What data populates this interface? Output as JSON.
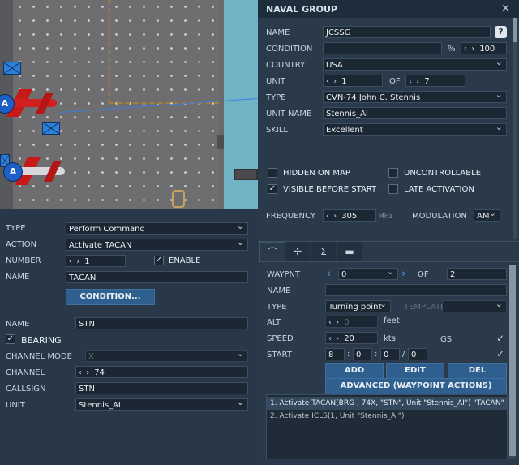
{
  "window": {
    "title": "NAVAL GROUP",
    "close_icon": "close-icon"
  },
  "group": {
    "name_label": "NAME",
    "name_value": "JCSSG",
    "help_label": "?",
    "condition_label": "CONDITION",
    "condition_value": "",
    "percent_label": "%",
    "percent_value": "100",
    "country_label": "COUNTRY",
    "country_value": "USA",
    "unit_label": "UNIT",
    "unit_value": "1",
    "of_label": "OF",
    "unit_total": "7",
    "type_label": "TYPE",
    "type_value": "CVN-74 John C. Stennis",
    "unit_name_label": "UNIT NAME",
    "unit_name_value": "Stennis_AI",
    "skill_label": "SKILL",
    "skill_value": "Excellent"
  },
  "flags": {
    "hidden_on_map": {
      "label": "HIDDEN ON MAP",
      "checked": false
    },
    "uncontrollable": {
      "label": "UNCONTROLLABLE",
      "checked": false
    },
    "visible_before_start": {
      "label": "VISIBLE BEFORE START",
      "checked": true
    },
    "late_activation": {
      "label": "LATE ACTIVATION",
      "checked": false
    }
  },
  "radio": {
    "frequency_label": "FREQUENCY",
    "frequency_value": "305",
    "frequency_unit": "MHz",
    "modulation_label": "MODULATION",
    "modulation_value": "AM"
  },
  "tabs": [
    {
      "icon": "route-icon",
      "glyph": "⌒",
      "active": true
    },
    {
      "icon": "aircraft-icon",
      "glyph": "✢",
      "active": false
    },
    {
      "icon": "sigma-icon",
      "glyph": "Σ",
      "active": false
    },
    {
      "icon": "payload-icon",
      "glyph": "▬",
      "active": false
    }
  ],
  "waypoint": {
    "wpt_label": "WAYPNT",
    "wpt_value": "0",
    "of_label": "OF",
    "wpt_total": "2",
    "name_label": "NAME",
    "name_value": "",
    "type_label": "TYPE",
    "type_value": "Turning point",
    "template_label": "TEMPLATE",
    "template_value": "",
    "alt_label": "ALT",
    "alt_value": "0",
    "alt_unit": "feet",
    "speed_label": "SPEED",
    "speed_value": "20",
    "speed_unit": "kts",
    "gs_label": "GS",
    "start_label": "START",
    "start_d": "8",
    "start_h": "0",
    "start_m": "0",
    "start_s": "0",
    "add_label": "ADD",
    "edit_label": "EDIT",
    "del_label": "DEL",
    "advanced_label": "ADVANCED (WAYPOINT ACTIONS)"
  },
  "actions": [
    "1. Activate TACAN(BRG , 74X, \"STN\", Unit \"Stennis_AI\")  \"TACAN\"",
    "2. Activate ICLS(1, Unit \"Stennis_AI\")"
  ],
  "command": {
    "type_label": "TYPE",
    "type_value": "Perform Command",
    "action_label": "ACTION",
    "action_value": "Activate TACAN",
    "number_label": "NUMBER",
    "number_value": "1",
    "enable_label": "ENABLE",
    "name_label": "NAME",
    "name_value": "TACAN",
    "condition_button": "CONDITION..."
  },
  "tacan": {
    "name_label": "NAME",
    "name_value": "STN",
    "bearing_label": "BEARING",
    "channel_mode_label": "CHANNEL MODE",
    "channel_mode_value": "X",
    "channel_label": "CHANNEL",
    "channel_value": "74",
    "callsign_label": "CALLSIGN",
    "callsign_value": "STN",
    "unit_label": "UNIT",
    "unit_value": "Stennis_AI"
  },
  "colors": {
    "accent": "#2f5f8f",
    "panel": "#2a3a4b",
    "title": "#1e2d3c",
    "selection_blue": "#2b80d8",
    "aircraft_red": "#d11e1e"
  }
}
